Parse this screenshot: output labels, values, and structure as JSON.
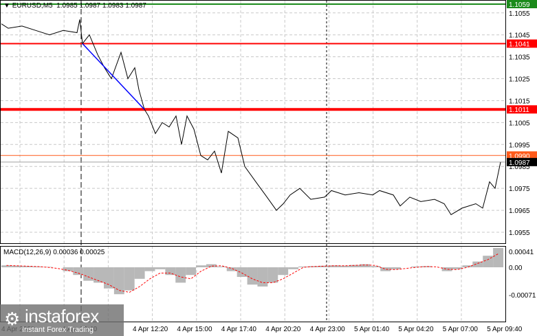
{
  "header": {
    "symbol": "EURUSD,M5",
    "ohlc": "1.0985 1.0987 1.0983 1.0987"
  },
  "macd": {
    "label": "MACD(12,26,9) 0.00036 0.00025",
    "ticks": [
      "0.00041",
      "0.00",
      "-0.00071"
    ]
  },
  "logo": {
    "name": "instaforex",
    "tagline": "Instant Forex Trading"
  },
  "price_ticks": [
    "1.1055",
    "1.1045",
    "1.1035",
    "1.1025",
    "1.1015",
    "1.1005",
    "1.0995",
    "1.0985",
    "1.0975",
    "1.0965",
    "1.0955"
  ],
  "levels": [
    {
      "price": 1.1059,
      "label": "1.1059",
      "color": "#1a8a1a"
    },
    {
      "price": 1.1041,
      "label": "1.1041",
      "color": "#ff0000"
    },
    {
      "price": 1.1011,
      "label": "1.1011",
      "color": "#ff0000"
    },
    {
      "price": 1.099,
      "label": "1.0990",
      "color": "#ff5a1a"
    },
    {
      "price": 1.0987,
      "label": "1.0987",
      "color": "#000000"
    }
  ],
  "time_labels": [
    "4 Apr 2022",
    "4 Apr 09:40",
    "4 Apr 12:20",
    "4 Apr 15:00",
    "4 Apr 17:40",
    "4 Apr 20:20",
    "4 Apr 23:00",
    "5 Apr 01:40",
    "5 Apr 04:20",
    "5 Apr 07:00",
    "5 Apr 09:40"
  ],
  "chart_data": {
    "type": "line",
    "title": "EURUSD,M5",
    "ylim": [
      1.095,
      1.1061
    ],
    "x": [
      0,
      5,
      15,
      25,
      35,
      45,
      55,
      57,
      59,
      64,
      70,
      75,
      80,
      87,
      92,
      97,
      100,
      104,
      107,
      112,
      117,
      122,
      127,
      131,
      135,
      140,
      145,
      150,
      155,
      160,
      165,
      172,
      177,
      185,
      192,
      200,
      205,
      210,
      217,
      225,
      235,
      240,
      250,
      260,
      270,
      275,
      285,
      290,
      297,
      305,
      315,
      322,
      327,
      335,
      345,
      350,
      355,
      359,
      363
    ],
    "price": [
      1.105,
      1.1048,
      1.1049,
      1.1047,
      1.1045,
      1.1047,
      1.1046,
      1.1052,
      1.1041,
      1.1045,
      1.1036,
      1.103,
      1.1025,
      1.1037,
      1.1025,
      1.103,
      1.102,
      1.1011,
      1.1008,
      1.1,
      1.1005,
      1.1003,
      1.1008,
      1.0995,
      1.1008,
      1.1002,
      1.099,
      1.0988,
      1.0992,
      1.0982,
      1.1001,
      1.0998,
      1.0985,
      1.0978,
      1.0972,
      1.0965,
      1.0968,
      1.0972,
      1.0975,
      1.097,
      1.0971,
      1.0974,
      1.0972,
      1.0973,
      1.0972,
      1.0974,
      1.0972,
      1.0967,
      1.0971,
      1.0969,
      1.097,
      1.0968,
      1.0963,
      1.0966,
      1.0968,
      1.0966,
      1.0978,
      1.0975,
      1.0987
    ],
    "trendline": {
      "from": [
        59,
        1.1041
      ],
      "to": [
        104,
        1.1011
      ]
    },
    "macd_ylim": [
      -0.00075,
      0.00045
    ],
    "macd_hist": [
      5e-05,
      4e-05,
      3e-05,
      2e-05,
      1e-05,
      0.0,
      -0.0001,
      -0.0002,
      -0.00035,
      -0.0004,
      -0.00055,
      -0.0007,
      -0.0006,
      -0.0003,
      -0.0001,
      -5e-05,
      -0.0002,
      -0.0004,
      -0.0002,
      5e-05,
      8e-05,
      2e-05,
      -0.0001,
      -0.00025,
      -0.00045,
      -0.0005,
      -0.0004,
      -0.0002,
      -5e-05,
      2e-05,
      3e-05,
      4e-05,
      5e-05,
      4e-05,
      6e-05,
      8e-05,
      3e-05,
      -0.0001,
      -5e-05,
      0.0,
      2e-05,
      3e-05,
      0.0,
      -0.0001,
      -5e-05,
      5e-05,
      0.00015,
      0.0003,
      0.0005
    ],
    "macd_signal": [
      5e-05,
      4e-05,
      3e-05,
      2e-05,
      0.0,
      -3e-05,
      -8e-05,
      -0.00015,
      -0.00025,
      -0.00035,
      -0.00045,
      -0.0006,
      -0.00065,
      -0.0005,
      -0.0003,
      -0.00015,
      -0.00015,
      -0.00025,
      -0.0003,
      -0.0001,
      3e-05,
      4e-05,
      -3e-05,
      -0.00015,
      -0.0003,
      -0.0004,
      -0.0004,
      -0.0003,
      -0.00015,
      0.0,
      2e-05,
      3e-05,
      4e-05,
      4e-05,
      5e-05,
      6e-05,
      5e-05,
      -5e-05,
      -6e-05,
      -3e-05,
      0.0,
      2e-05,
      1e-05,
      -5e-05,
      -6e-05,
      0.0,
      0.0001,
      0.0002,
      0.00035
    ]
  }
}
